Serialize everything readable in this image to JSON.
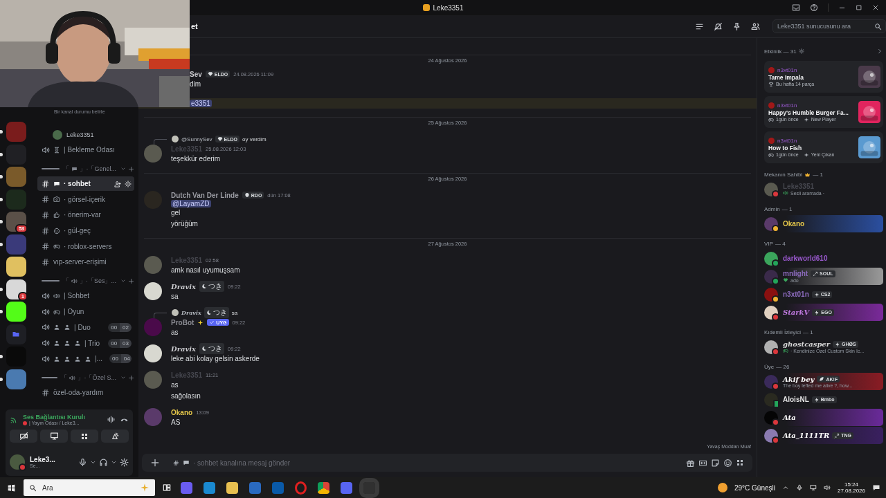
{
  "window": {
    "title": "Leke3351"
  },
  "servers": [
    {
      "color": "#7a1c1c",
      "unread": true
    },
    {
      "color": "#202024",
      "unread": true
    },
    {
      "color": "#7a5a2a",
      "unread": true
    },
    {
      "color": "#1c2a1c",
      "unread": true
    },
    {
      "color": "#5a5048",
      "unread": true,
      "badge": "53"
    },
    {
      "color": "#3a3a7a",
      "unread": true
    },
    {
      "color": "#e0c060",
      "unread": false
    },
    {
      "color": "#d8d8d8",
      "unread": true,
      "badge": "1"
    },
    {
      "color": "#53fc18",
      "unread": true
    },
    {
      "color": "#5865f2",
      "unread": false,
      "kind": "folder"
    },
    {
      "color": "#0a0a0a",
      "unread": true
    },
    {
      "color": "#4a7ab0",
      "unread": true
    }
  ],
  "channels": [
    {
      "kind": "status",
      "text": "Bir kanal durumu belirle"
    },
    {
      "kind": "member",
      "name": "Leke3351"
    },
    {
      "kind": "voice",
      "name": "| Bekleme Odası",
      "selected": false
    },
    {
      "kind": "category",
      "open": "「",
      "name": "」·「Genel..."
    },
    {
      "kind": "text",
      "name": "· sohbet",
      "selected": true
    },
    {
      "kind": "text",
      "name": "· görsel-içerik",
      "selected": false
    },
    {
      "kind": "text",
      "name": "· önerim-var",
      "selected": false
    },
    {
      "kind": "text",
      "name": "· gül-geç",
      "selected": false
    },
    {
      "kind": "text",
      "name": "· roblox-servers",
      "selected": false
    },
    {
      "kind": "text",
      "name": "vıp-server-erişimi",
      "selected": false
    },
    {
      "kind": "category",
      "open": "「",
      "name": "」·「Ses」..."
    },
    {
      "kind": "voice",
      "name": "| Sohbet",
      "selected": false
    },
    {
      "kind": "voice",
      "name": "| Oyun",
      "selected": false
    },
    {
      "kind": "voice",
      "name": "| Duo",
      "count": [
        "00",
        "02"
      ],
      "selected": false
    },
    {
      "kind": "voice",
      "name": "| Trio",
      "count": [
        "00",
        "03"
      ],
      "selected": false
    },
    {
      "kind": "voice",
      "name": "|...",
      "count": [
        "00",
        "04"
      ],
      "selected": false
    },
    {
      "kind": "category",
      "open": "「",
      "name": "」·「Özel S..."
    },
    {
      "kind": "text",
      "name": "özel-oda-yardım",
      "selected": false
    }
  ],
  "voice_panel": {
    "title": "Ses Bağlantısı Kurulı",
    "subtitle": "| Yayın Odası / Leke3..."
  },
  "user": {
    "name": "Leke3...",
    "status": "Se..."
  },
  "header": {
    "channel": "et",
    "search": {
      "placeholder": "Leke3351 sunucusunu ara"
    }
  },
  "messages": [
    {
      "kind": "date",
      "text": "24 Ağustos 2026"
    },
    {
      "kind": "partial",
      "author": "Sev",
      "tag": {
        "kind": "diamond",
        "text": "ELDO"
      },
      "time": "24.08.2026 11:09",
      "lines": [
        "dim"
      ]
    },
    {
      "kind": "mention-row",
      "text": "e3351"
    },
    {
      "kind": "date",
      "text": "25 Ağustos 2026"
    },
    {
      "kind": "message",
      "author": "Leke3351",
      "color": "#45464e",
      "fancy": false,
      "reply": {
        "author": "@SunnySev",
        "fancy": false,
        "tag": {
          "kind": "diamond",
          "text": "ELDO"
        },
        "text": "oy verdim"
      },
      "time": "25.08.2026 12:03",
      "lines": [
        "teşekkür ederim"
      ]
    },
    {
      "kind": "date",
      "text": "26 Ağustos 2026"
    },
    {
      "kind": "message",
      "author": "Dutch Van Der Linde",
      "color": "#9a9ba2",
      "fancy": false,
      "tag": {
        "kind": "skull",
        "text": "RDO"
      },
      "time": "dün 17:08",
      "mention": "@LayamZD",
      "lines": [
        "gel",
        "yörüğüm"
      ]
    },
    {
      "kind": "date",
      "text": "27 Ağustos 2026"
    },
    {
      "kind": "message",
      "author": "Leke3351",
      "color": "#45464e",
      "fancy": false,
      "time": "02:58",
      "lines": [
        "amk nasıl uyumuşsam"
      ]
    },
    {
      "kind": "message",
      "author": "Dravix",
      "color": "#c8c8cc",
      "fancy": true,
      "tag": {
        "kind": "moon",
        "text": "つき"
      },
      "time": "09:22",
      "lines": [
        "sa"
      ]
    },
    {
      "kind": "message",
      "author": "ProBot",
      "color": "#8a8b92",
      "fancy": false,
      "bot": true,
      "reply": {
        "author": "Dravix",
        "fancy": true,
        "tag": {
          "kind": "moon",
          "text": "つき"
        },
        "text": "sa"
      },
      "tag": {
        "kind": "check",
        "text": "UYG"
      },
      "time": "09:22",
      "lines": [
        "as"
      ]
    },
    {
      "kind": "message",
      "author": "Dravix",
      "color": "#c8c8cc",
      "fancy": true,
      "tag": {
        "kind": "moon",
        "text": "つき"
      },
      "time": "09:22",
      "lines": [
        "leke abi kolay gelsin askerde"
      ]
    },
    {
      "kind": "message",
      "author": "Leke3351",
      "color": "#45464e",
      "fancy": false,
      "time": "11:21",
      "lines": [
        "as",
        "sağolasın"
      ]
    },
    {
      "kind": "message",
      "author": "Okano",
      "color": "#e6c84a",
      "fancy": false,
      "time": "13:09",
      "lines": [
        "AS"
      ]
    }
  ],
  "slowmode": "Yavaş Moddan Muaf",
  "composer": {
    "placeholder": "· sohbet kanalına mesaj gönder"
  },
  "activity": {
    "title": "Etkinlik — 31",
    "cards": [
      {
        "user": "n3xt01n",
        "title": "Tame Impala",
        "color": "#4a3a4a",
        "meta": [
          {
            "kind": "trophy",
            "text": "Bu hafta 14 parça"
          }
        ]
      },
      {
        "user": "n3xt01n",
        "title": "Happy's Humble Burger Fa...",
        "color": "#e0245e",
        "meta": [
          {
            "kind": "gamepad",
            "text": "1gün önce"
          },
          {
            "kind": "sparkle",
            "text": "New Player"
          }
        ]
      },
      {
        "user": "n3xt01n",
        "title": "How to Fish",
        "color": "#5a9ad0",
        "meta": [
          {
            "kind": "gamepad",
            "text": "1gün önce"
          },
          {
            "kind": "sparkle",
            "text": "Yeni Çıkan"
          }
        ]
      }
    ]
  },
  "groups": [
    {
      "title": "Mekanın Sahibi",
      "crown": true,
      "count": "— 1",
      "members": [
        {
          "name": "Leke3351",
          "color": "#45464e",
          "kind": "dnd",
          "fancy": false,
          "banner": false,
          "sub": {
            "kind": "speaker",
            "text": "Sesli aramada ·"
          }
        }
      ]
    },
    {
      "title": "Admin",
      "crown": false,
      "count": "— 1",
      "members": [
        {
          "name": "Okano",
          "color": "#e6c84a",
          "kind": "idle",
          "fancy": false,
          "banner": true
        }
      ]
    },
    {
      "title": "VIP",
      "crown": false,
      "count": "— 4",
      "members": [
        {
          "name": "darkworld610",
          "color": "#9b59d0",
          "kind": "online",
          "fancy": false,
          "banner": false
        },
        {
          "name": "mnlight",
          "color": "#8e6cc0",
          "kind": "online",
          "fancy": false,
          "banner": true,
          "tag": {
            "kind": "sword",
            "text": "SOUL"
          },
          "sub": {
            "kind": "heart",
            "text": "ado"
          }
        },
        {
          "name": "n3xt01n",
          "color": "#8e6cc0",
          "kind": "idle",
          "fancy": false,
          "banner": false,
          "tag": {
            "kind": "sparkle",
            "text": "CS2"
          }
        },
        {
          "name": "StarkV",
          "color": "#c07ae0",
          "kind": "dnd",
          "fancy": true,
          "banner": true,
          "tag": {
            "kind": "bolt",
            "text": "EGO"
          }
        }
      ]
    },
    {
      "title": "Kıdemli İzleyici",
      "crown": false,
      "count": "— 1",
      "members": [
        {
          "name": "ghostcasper",
          "color": "#d8d8d8",
          "kind": "dnd",
          "fancy": true,
          "banner": false,
          "tag": {
            "kind": "bolt",
            "text": "GHØS"
          },
          "sub": {
            "kind": "gamepad",
            "text": "· Kendinize Ozel Custom Skin Ic..."
          }
        }
      ]
    },
    {
      "title": "Üye",
      "crown": false,
      "count": "— 26",
      "members": [
        {
          "name": "Akif bey",
          "color": "#ffffff",
          "kind": "dnd",
          "fancy": true,
          "banner": true,
          "tag": {
            "kind": "leaf",
            "text": "AK!F"
          },
          "sub": {
            "kind": "plain",
            "text": "The boy lefted me alive ?, how..."
          }
        },
        {
          "name": "AloisNL",
          "color": "#e6e6e6",
          "kind": "mobile",
          "fancy": false,
          "banner": false,
          "tag": {
            "kind": "bolt",
            "text": "Bmbo"
          }
        },
        {
          "name": "Ata",
          "color": "#ffffff",
          "kind": "dnd",
          "fancy": true,
          "banner": true
        },
        {
          "name": "Ata_1111TR",
          "color": "#ffffff",
          "kind": "dnd",
          "fancy": true,
          "banner": true,
          "tag": {
            "kind": "sword",
            "text": "TNG"
          }
        }
      ]
    }
  ],
  "taskbar": {
    "search": "Ara",
    "weather": "29°C  Güneşli",
    "time": "15:24",
    "date": "27.08.2026"
  }
}
